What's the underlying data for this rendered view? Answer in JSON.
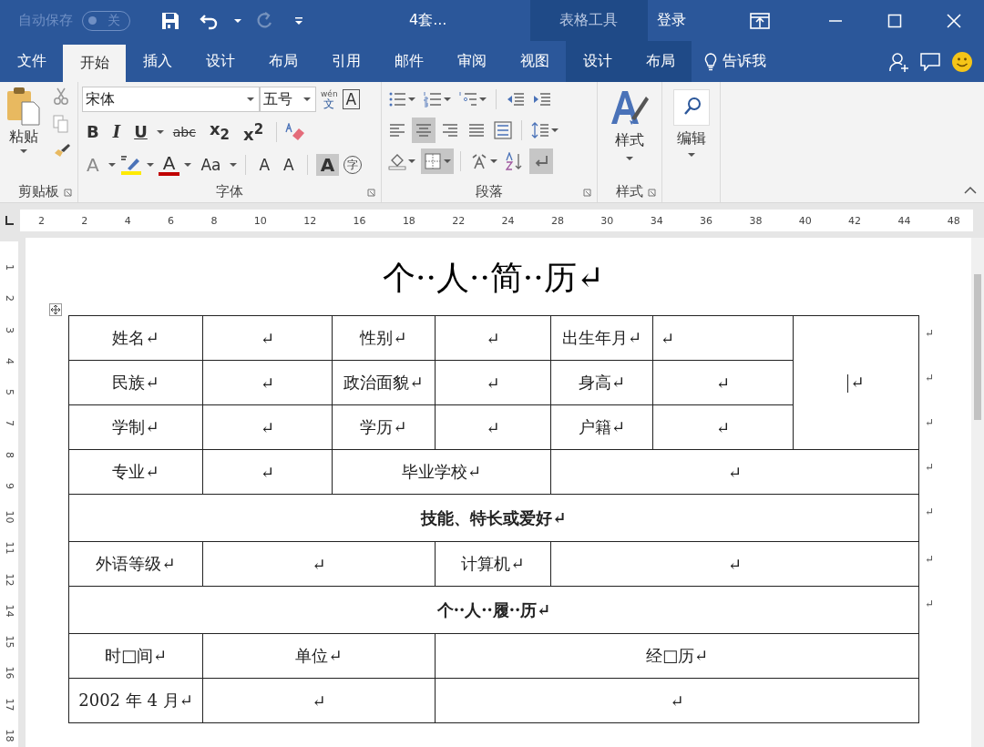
{
  "title_bar": {
    "autosave_label": "自动保存",
    "autosave_toggle": {
      "on": false,
      "label": "关"
    },
    "redo_disabled": true,
    "document_title": "4套...",
    "context_label": "表格工具",
    "sign_in": "登录"
  },
  "tabs": [
    {
      "label": "文件",
      "selected": false,
      "kind": "main"
    },
    {
      "label": "开始",
      "selected": true,
      "kind": "main"
    },
    {
      "label": "插入",
      "selected": false,
      "kind": "main"
    },
    {
      "label": "设计",
      "selected": false,
      "kind": "main"
    },
    {
      "label": "布局",
      "selected": false,
      "kind": "main"
    },
    {
      "label": "引用",
      "selected": false,
      "kind": "main"
    },
    {
      "label": "邮件",
      "selected": false,
      "kind": "main"
    },
    {
      "label": "审阅",
      "selected": false,
      "kind": "main"
    },
    {
      "label": "视图",
      "selected": false,
      "kind": "main"
    },
    {
      "label": "设计",
      "selected": false,
      "kind": "context"
    },
    {
      "label": "布局",
      "selected": false,
      "kind": "context"
    }
  ],
  "tell_me": "告诉我",
  "ribbon": {
    "clipboard": {
      "paste_label": "粘贴",
      "group_label": "剪贴板"
    },
    "font": {
      "font_name": "宋体",
      "font_size": "五号",
      "phonetic_top": "wén",
      "phonetic_char": "文",
      "border_char": "A",
      "group_label": "字体",
      "row2": [
        {
          "label": "B",
          "kind": "bold"
        },
        {
          "label": "I",
          "kind": "italic"
        },
        {
          "label": "U",
          "kind": "underline"
        },
        {
          "label": "abc",
          "kind": "strike"
        },
        {
          "label": "x$_{2}$",
          "kind": "script"
        },
        {
          "label": "x$^{2}$",
          "kind": "script"
        }
      ],
      "row3": [
        {
          "label": "A",
          "kind": "effects"
        },
        {
          "kind": "highlight"
        },
        {
          "label": "A",
          "kind": "color"
        },
        {
          "label": "Aa",
          "kind": "case"
        },
        {
          "label": "A",
          "kind": "grow"
        },
        {
          "label": "A",
          "kind": "shrink"
        },
        {
          "label": "A",
          "kind": "shading"
        },
        {
          "label": "字",
          "kind": "enclose"
        }
      ]
    },
    "paragraph": {
      "group_label": "段落",
      "rows": [
        [
          {
            "kind": "bullets",
            "selected": false
          },
          {
            "kind": "numbering",
            "selected": false
          },
          {
            "kind": "multilevel",
            "selected": false
          },
          {
            "kind": "outdent",
            "selected": false
          },
          {
            "kind": "indent",
            "selected": false
          }
        ],
        [
          {
            "kind": "align-left",
            "selected": false
          },
          {
            "kind": "align-center",
            "selected": true
          },
          {
            "kind": "align-right",
            "selected": false
          },
          {
            "kind": "justify",
            "selected": false
          },
          {
            "kind": "distribute",
            "selected": false
          },
          {
            "kind": "spacing",
            "selected": false
          }
        ],
        [
          {
            "kind": "shading",
            "selected": false
          },
          {
            "kind": "borders",
            "selected": true
          },
          {
            "kind": "asian",
            "selected": false
          },
          {
            "kind": "sort",
            "selected": false
          },
          {
            "kind": "marks",
            "selected": true
          }
        ]
      ]
    },
    "styles": {
      "button_label": "样式",
      "group_label": "样式"
    },
    "editing": {
      "button_label": "编辑"
    }
  },
  "ruler": {
    "h_numbers": [
      "2",
      "2",
      "4",
      "6",
      "8",
      "10",
      "12",
      "16",
      "18",
      "22",
      "24",
      "28",
      "30",
      "34",
      "36",
      "38",
      "40",
      "42",
      "44",
      "48"
    ],
    "v_numbers": [
      "1",
      "2",
      "3",
      "4",
      "5",
      "7",
      "8",
      "9",
      "10",
      "11",
      "12",
      "14",
      "15",
      "16",
      "17",
      "18"
    ]
  },
  "document": {
    "title": "个··人··简··历↵",
    "rows": [
      {
        "end_mark": "↵",
        "cells": [
          {
            "text": "姓名↵"
          },
          {
            "text": "↵"
          },
          {
            "text": "性别↵"
          },
          {
            "text": "↵"
          },
          {
            "text": "出生年月↵"
          },
          {
            "text": "↵",
            "left_aligned": true
          },
          {
            "text": "↵",
            "rowspan": 3,
            "cursor": true
          }
        ]
      },
      {
        "end_mark": "↵",
        "cells": [
          {
            "text": "民族↵"
          },
          {
            "text": "↵"
          },
          {
            "text": "政治面貌↵"
          },
          {
            "text": "↵"
          },
          {
            "text": "身高↵"
          },
          {
            "text": "↵"
          }
        ]
      },
      {
        "end_mark": "↵",
        "cells": [
          {
            "text": "学制↵"
          },
          {
            "text": "↵"
          },
          {
            "text": "学历↵"
          },
          {
            "text": "↵"
          },
          {
            "text": "户籍↵"
          },
          {
            "text": "↵"
          }
        ]
      },
      {
        "end_mark": "↵",
        "cells": [
          {
            "text": "专业↵"
          },
          {
            "text": "↵"
          },
          {
            "text": "毕业学校↵",
            "colspan": 2
          },
          {
            "text": "↵",
            "colspan": 3
          }
        ]
      },
      {
        "end_mark": "↵",
        "cells": [
          {
            "text": "技能、特长或爱好↵",
            "colspan": 7,
            "kind": "heading"
          }
        ]
      },
      {
        "end_mark": "↵",
        "cells": [
          {
            "text": "外语等级↵"
          },
          {
            "text": "↵",
            "colspan": 2
          },
          {
            "text": "计算机↵"
          },
          {
            "text": "↵",
            "colspan": 3
          }
        ]
      },
      {
        "end_mark": "↵",
        "cells": [
          {
            "text": "个··人··履··历↵",
            "colspan": 7,
            "kind": "heading"
          }
        ]
      },
      {
        "cells": [
          {
            "text": "时□间↵"
          },
          {
            "text": "单位↵",
            "colspan": 2
          },
          {
            "text": "经□历↵",
            "colspan": 4
          }
        ]
      },
      {
        "cells": [
          {
            "text": "2002 年 4 月↵"
          },
          {
            "text": "↵",
            "colspan": 2
          },
          {
            "text": "↵",
            "colspan": 4
          }
        ]
      }
    ]
  }
}
